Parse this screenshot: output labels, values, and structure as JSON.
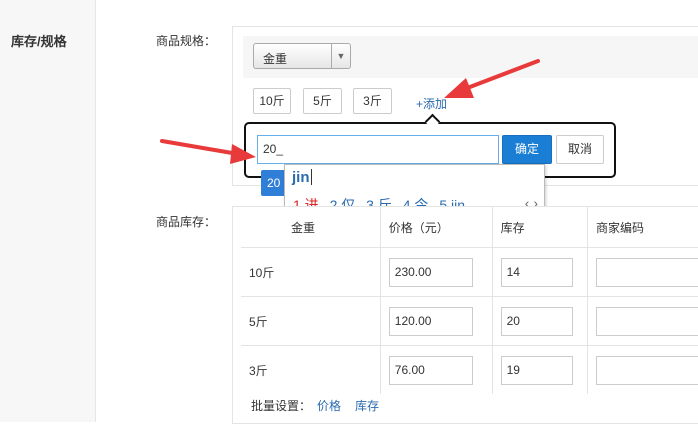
{
  "section_title": "库存/规格",
  "spec_label": "商品规格：",
  "stock_label": "商品库存：",
  "select_value": "金重",
  "chips": [
    "10斤",
    "5斤",
    "3斤"
  ],
  "add_link": "+添加",
  "popup": {
    "input_value": "20_",
    "confirm": "确定",
    "cancel": "取消",
    "suggestion": "20"
  },
  "ime": {
    "composition": "jin",
    "candidates": [
      "1.进",
      "2.仅",
      "3.斤",
      "4.今",
      "5.jin"
    ],
    "nav": "‹ ›"
  },
  "table": {
    "headers": [
      "金重",
      "价格（元）",
      "库存",
      "商家编码"
    ],
    "rows": [
      {
        "spec": "10斤",
        "price": "230.00",
        "stock": "14",
        "code": ""
      },
      {
        "spec": "5斤",
        "price": "120.00",
        "stock": "20",
        "code": ""
      },
      {
        "spec": "3斤",
        "price": "76.00",
        "stock": "19",
        "code": ""
      }
    ]
  },
  "batch": {
    "label": "批量设置：",
    "price": "价格",
    "stock": "库存"
  },
  "colors": {
    "accent": "#1a7fd4",
    "link": "#2a6bb0",
    "annotation_arrow": "#e83a3a"
  }
}
